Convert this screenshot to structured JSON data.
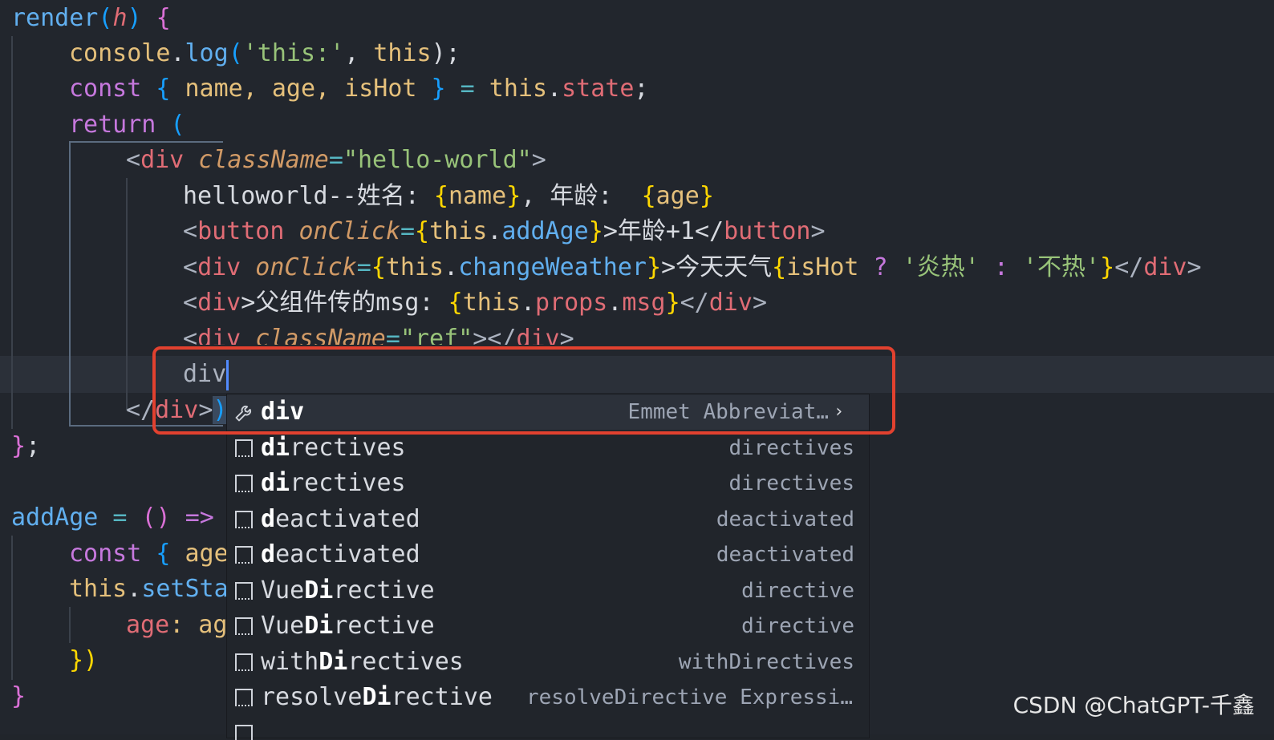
{
  "code": {
    "l1": {
      "kw": "render",
      "p1": "(",
      "arg": "h",
      "p2": ")",
      "b": " {"
    },
    "l2": {
      "obj": "console",
      "dot": ".",
      "m": "log",
      "o": "(",
      "s": "'this:'",
      "c": ", ",
      "th": "this",
      "e": ");"
    },
    "l3": {
      "kw": "const",
      "b1": " { ",
      "vars": "name, age, isHot",
      "b2": " } ",
      "eq": "=",
      "sp": " ",
      "th": "this",
      "dot": ".",
      "pr": "state",
      "e": ";"
    },
    "l4": {
      "kw": "return",
      "b": " ("
    },
    "l5": {
      "lt": "<",
      "tag": "div",
      "attr": " className",
      "eq": "=",
      "val": "\"hello-world\"",
      "gt": ">"
    },
    "l6": {
      "txt": "helloworld--姓名: ",
      "ob": "{",
      "v": "name",
      "cb": "}",
      "txt2": ", 年龄:  ",
      "ob2": "{",
      "v2": "age",
      "cb2": "}"
    },
    "l7": {
      "lt": "<",
      "tag": "button",
      "attr": " onClick",
      "eq": "=",
      "ob": "{",
      "th": "this",
      "dot": ".",
      "m": "addAge",
      "cb": "}",
      "txt": ">年龄+1</",
      "tag2": "button",
      "gt": ">"
    },
    "l8": {
      "lt": "<",
      "tag": "div",
      "attr": " onClick",
      "eq": "=",
      "ob": "{",
      "th": "this",
      "dot": ".",
      "m": "changeWeather",
      "cb": "}",
      "txt": ">今天天气",
      "ob2": "{",
      "v": "isHot",
      "q": " ? ",
      "s1": "'炎热'",
      "col": " : ",
      "s2": "'不热'",
      "cb2": "}",
      "end": "</",
      "tag2": "div",
      "gt": ">"
    },
    "l9": {
      "lt": "<",
      "tag": "div",
      "txt": ">父组件传的msg: ",
      "ob": "{",
      "th": "this",
      "dot": ".",
      "pr": "props",
      "dot2": ".",
      "pr2": "msg",
      "cb": "}",
      "end": "</",
      "tag2": "div",
      "gt": ">"
    },
    "l10": {
      "lt": "<",
      "tag": "div",
      "attr": " className",
      "eq": "=",
      "val": "\"ref\"",
      "gt": "></",
      "tag2": "div",
      "gt2": ">"
    },
    "l11": {
      "typed": "div"
    },
    "l12": {
      "end": "</",
      "tag": "div",
      "gt": ">",
      "cp": ")"
    },
    "l13": {
      "b": "}",
      "e": ";"
    },
    "l15": {
      "name": "addAge",
      "eq": " = ",
      "pa": "()",
      "arrow": " =>"
    },
    "l16": {
      "kw": "const",
      "b": " { ",
      "v": "age"
    },
    "l17": {
      "th": "this",
      "dot": ".",
      "m": "setSta"
    },
    "l18": {
      "v": "age",
      "c": ": ag"
    },
    "l19": {
      "b": "})"
    },
    "l20": {
      "b": "}"
    }
  },
  "suggestions": [
    {
      "icon": "wrench-icon",
      "match": "div",
      "rest": "",
      "detail": "Emmet Abbreviat…",
      "selected": true
    },
    {
      "icon": "text-icon",
      "pre": "",
      "match": "di",
      "rest": "rectives",
      "detail": "directives"
    },
    {
      "icon": "text-icon",
      "pre": "",
      "match": "di",
      "rest": "rectives",
      "detail": "directives"
    },
    {
      "icon": "text-icon",
      "pre": "",
      "match": "d",
      "rest": "eactivated",
      "detail": "deactivated"
    },
    {
      "icon": "text-icon",
      "pre": "",
      "match": "d",
      "rest": "eactivated",
      "detail": "deactivated"
    },
    {
      "icon": "text-icon",
      "pre": "Vue",
      "match": "Di",
      "rest": "rective",
      "detail": "directive"
    },
    {
      "icon": "text-icon",
      "pre": "Vue",
      "match": "Di",
      "rest": "rective",
      "detail": "directive"
    },
    {
      "icon": "text-icon",
      "pre": "with",
      "match": "Di",
      "rest": "rectives",
      "detail": "withDirectives"
    },
    {
      "icon": "text-icon",
      "pre": "resolve",
      "match": "Di",
      "rest": "rective",
      "detail": "resolveDirective Expressi…"
    }
  ],
  "watermark": "CSDN @ChatGPT-千鑫"
}
